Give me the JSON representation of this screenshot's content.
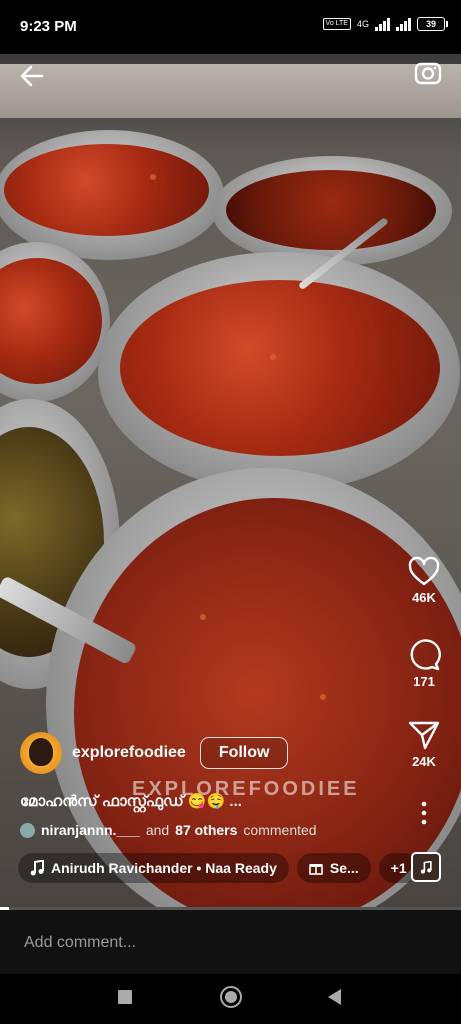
{
  "status_bar": {
    "time": "9:23 PM",
    "volte": "Vo LTE",
    "network": "4G",
    "battery": "39"
  },
  "post": {
    "watermark": "EXPLOREFOODIEE",
    "username": "explorefoodiee",
    "follow_label": "Follow",
    "caption": "മോഹൻസ് ഫാസ്റ്റ്ഫുഡ് 😋🤤",
    "caption_more": "...",
    "commenter": "niranjannn.___",
    "comment_connector": "and",
    "comment_others": "87 others",
    "comment_suffix": "commented",
    "audio_label": "Anirudh Ravichander • Naa Ready",
    "gift_label": "Se...",
    "collab_count": "+1",
    "progress": 0.02
  },
  "actions": {
    "likes": "46K",
    "comments": "171",
    "shares": "24K"
  },
  "comment_input": {
    "placeholder": "Add comment..."
  },
  "icons": [
    "back-arrow-icon",
    "camera-icon",
    "heart-icon",
    "comment-icon",
    "share-icon",
    "more-icon",
    "music-note-icon",
    "gift-icon"
  ]
}
